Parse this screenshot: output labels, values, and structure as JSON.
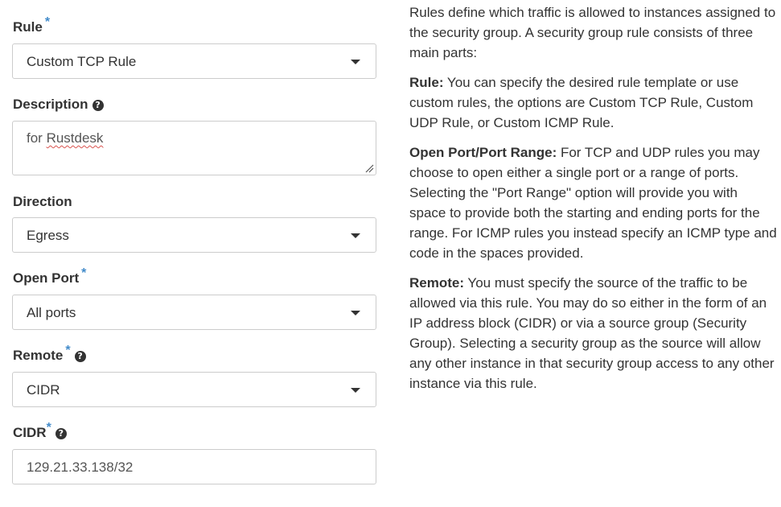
{
  "form": {
    "rule": {
      "label": "Rule",
      "required": "*",
      "value": "Custom TCP Rule"
    },
    "description": {
      "label": "Description",
      "help": "?",
      "value_prefix": "for ",
      "value_word": "Rustdesk"
    },
    "direction": {
      "label": "Direction",
      "value": "Egress"
    },
    "open_port": {
      "label": "Open Port",
      "required": "*",
      "value": "All ports"
    },
    "remote": {
      "label": "Remote",
      "required": "*",
      "help": "?",
      "value": "CIDR"
    },
    "cidr": {
      "label": "CIDR",
      "required": "*",
      "help": "?",
      "value": "129.21.33.138/32"
    }
  },
  "help_panel": {
    "intro": "Rules define which traffic is allowed to instances assigned to the security group. A security group rule consists of three main parts:",
    "rule_title": "Rule:",
    "rule_text": " You can specify the desired rule template or use custom rules, the options are Custom TCP Rule, Custom UDP Rule, or Custom ICMP Rule.",
    "port_title": "Open Port/Port Range:",
    "port_text": " For TCP and UDP rules you may choose to open either a single port or a range of ports. Selecting the \"Port Range\" option will provide you with space to provide both the starting and ending ports for the range. For ICMP rules you instead specify an ICMP type and code in the spaces provided.",
    "remote_title": "Remote:",
    "remote_text": " You must specify the source of the traffic to be allowed via this rule. You may do so either in the form of an IP address block (CIDR) or via a source group (Security Group). Selecting a security group as the source will allow any other instance in that security group access to any other instance via this rule."
  },
  "colors": {
    "required_star": "#428bca",
    "border": "#cccccc",
    "text": "#333333",
    "spellcheck": "#d9534f"
  },
  "icons": {
    "help": "question-circle-icon",
    "dropdown": "caret-down-icon",
    "resize": "resize-handle-icon"
  }
}
